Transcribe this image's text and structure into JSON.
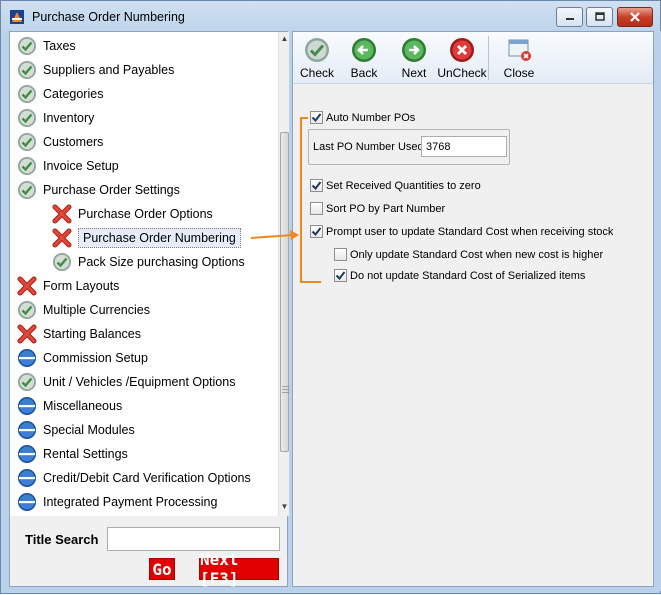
{
  "window": {
    "title": "Purchase Order Numbering"
  },
  "tree": {
    "items": [
      {
        "label": "Taxes",
        "status": "check",
        "level": 0
      },
      {
        "label": "Suppliers and Payables",
        "status": "check",
        "level": 0
      },
      {
        "label": "Categories",
        "status": "check",
        "level": 0
      },
      {
        "label": "Inventory",
        "status": "check",
        "level": 0
      },
      {
        "label": "Customers",
        "status": "check",
        "level": 0
      },
      {
        "label": "Invoice Setup",
        "status": "check",
        "level": 0
      },
      {
        "label": "Purchase Order Settings",
        "status": "check",
        "level": 0
      },
      {
        "label": "Purchase Order Options",
        "status": "cross",
        "level": 1
      },
      {
        "label": "Purchase Order Numbering",
        "status": "cross",
        "level": 1,
        "selected": true
      },
      {
        "label": "Pack Size purchasing Options",
        "status": "check",
        "level": 1
      },
      {
        "label": "Form Layouts",
        "status": "cross",
        "level": 0
      },
      {
        "label": "Multiple Currencies",
        "status": "check",
        "level": 0
      },
      {
        "label": "Starting Balances",
        "status": "cross",
        "level": 0
      },
      {
        "label": "Commission Setup",
        "status": "blue",
        "level": 0
      },
      {
        "label": "Unit / Vehicles /Equipment Options",
        "status": "check",
        "level": 0
      },
      {
        "label": "Miscellaneous",
        "status": "blue",
        "level": 0
      },
      {
        "label": "Special Modules",
        "status": "blue",
        "level": 0
      },
      {
        "label": "Rental Settings",
        "status": "blue",
        "level": 0
      },
      {
        "label": "Credit/Debit Card Verification Options",
        "status": "blue",
        "level": 0
      },
      {
        "label": "Integrated Payment Processing",
        "status": "blue",
        "level": 0
      }
    ]
  },
  "search": {
    "label": "Title Search",
    "value": "",
    "go_label": "Go",
    "next_label": "Next [F3]"
  },
  "toolbar": {
    "check_label": "Check",
    "back_label": "Back",
    "next_label": "Next",
    "uncheck_label": "UnCheck",
    "close_label": "Close"
  },
  "form": {
    "auto_number": {
      "label": "Auto Number POs",
      "checked": true
    },
    "last_po_label": "Last PO Number Used",
    "last_po_value": "3768",
    "set_received": {
      "label": "Set Received Quantities to zero",
      "checked": true
    },
    "sort_po": {
      "label": "Sort PO by Part Number",
      "checked": false
    },
    "prompt_update": {
      "label": "Prompt user to update Standard Cost when receiving stock",
      "checked": true
    },
    "only_update": {
      "label": "Only update Standard Cost when new cost is higher",
      "checked": false
    },
    "no_update_serialized": {
      "label": "Do not update Standard Cost of Serialized items",
      "checked": true
    }
  },
  "colors": {
    "accent_orange": "#f0861e",
    "go_red": "#e00000",
    "check_green": "#4caf50",
    "cross_red": "#d9362a",
    "pending_blue": "#2b67c4"
  }
}
